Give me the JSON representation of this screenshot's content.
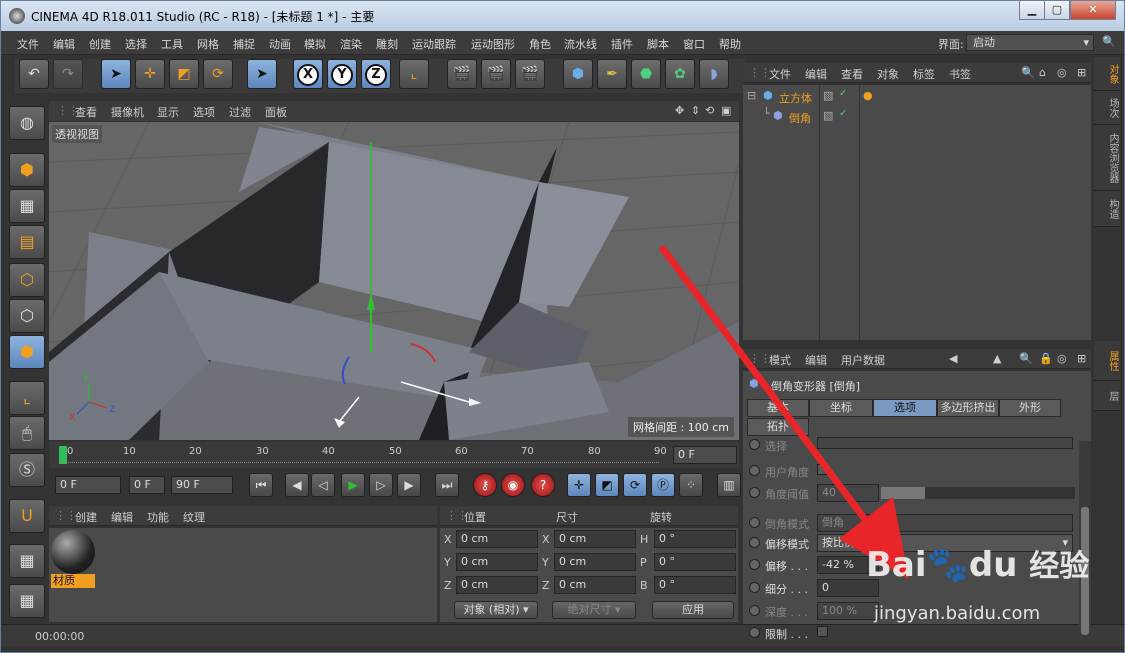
{
  "window": {
    "title": "CINEMA 4D R18.011 Studio (RC - R18) - [未标题 1 *] - 主要"
  },
  "menu": [
    "文件",
    "编辑",
    "创建",
    "选择",
    "工具",
    "网格",
    "捕捉",
    "动画",
    "模拟",
    "渲染",
    "雕刻",
    "运动跟踪",
    "运动图形",
    "角色",
    "流水线",
    "插件",
    "脚本",
    "窗口",
    "帮助"
  ],
  "interface": {
    "label": "界面:",
    "value": "启动"
  },
  "viewport": {
    "menu": [
      "查看",
      "摄像机",
      "显示",
      "选项",
      "过滤",
      "面板"
    ],
    "label": "透视视图",
    "grid_label": "网格间距 : 100 cm"
  },
  "timeline": {
    "ticks": [
      "0",
      "10",
      "20",
      "30",
      "40",
      "50",
      "60",
      "70",
      "80",
      "90"
    ],
    "end_field": "0 F"
  },
  "transport": {
    "start": "0 F",
    "current": "0 F",
    "end": "90 F"
  },
  "materials": {
    "menu": [
      "创建",
      "编辑",
      "功能",
      "纹理"
    ],
    "item": "材质"
  },
  "coords": {
    "headers": [
      "位置",
      "尺寸",
      "旋转"
    ],
    "rows": [
      {
        "a": "X",
        "av": "0 cm",
        "b": "X",
        "bv": "0 cm",
        "c": "H",
        "cv": "0 °"
      },
      {
        "a": "Y",
        "av": "0 cm",
        "b": "Y",
        "bv": "0 cm",
        "c": "P",
        "cv": "0 °"
      },
      {
        "a": "Z",
        "av": "0 cm",
        "b": "Z",
        "bv": "0 cm",
        "c": "B",
        "cv": "0 °"
      }
    ],
    "mode": "对象 (相对)",
    "size_mode": "绝对尺寸",
    "apply": "应用"
  },
  "status": {
    "time": "00:00:00"
  },
  "objects": {
    "menu": [
      "文件",
      "编辑",
      "查看",
      "对象",
      "标签",
      "书签"
    ],
    "items": [
      "立方体",
      "倒角"
    ]
  },
  "right_tabs_top": [
    "对象",
    "场次",
    "内容浏览器",
    "构造"
  ],
  "right_tabs_bottom": [
    "属性",
    "层"
  ],
  "attributes": {
    "menu": [
      "模式",
      "编辑",
      "用户数据"
    ],
    "object": "倒角变形器 [倒角]",
    "tabs": [
      "基本",
      "坐标",
      "选项",
      "多边形挤出",
      "外形",
      "拓扑"
    ],
    "rows": [
      {
        "label": "选择",
        "value": ""
      },
      {
        "label": "用户角度",
        "value": ""
      },
      {
        "label": "角度阈值",
        "value": "40 °"
      },
      {
        "label": "倒角模式",
        "value": "倒角"
      },
      {
        "label": "偏移模式",
        "value": "按比例"
      },
      {
        "label": "偏移 . . .",
        "value": "-42 %"
      },
      {
        "label": "细分 . . .",
        "value": "0"
      },
      {
        "label": "深度 . . .",
        "value": "100 %"
      },
      {
        "label": "限制 . . .",
        "value": ""
      }
    ]
  },
  "watermark": {
    "brand": "Bai",
    "brand2": "du",
    "slogan": "经验",
    "url": "jingyan.baidu.com"
  },
  "colors": {
    "accent": "#f0a020",
    "arrow": "#e8262a",
    "selected_tab": "#7a9ac4"
  }
}
